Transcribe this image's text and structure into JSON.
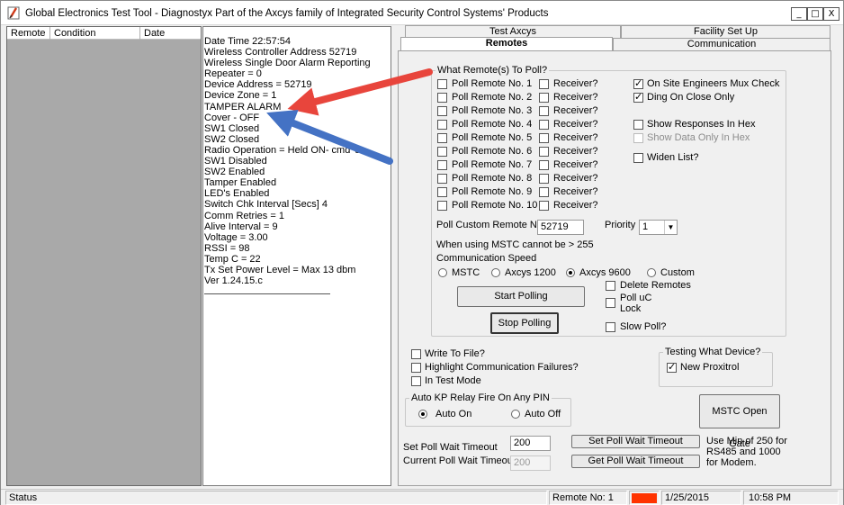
{
  "window": {
    "title": "Global Electronics Test Tool - Diagnostyx  Part of the Axcys family of Integrated Security Control Systems' Products",
    "controls": [
      "_",
      "□",
      "X"
    ]
  },
  "list": {
    "columns": [
      "Remote",
      "Condition",
      "Date"
    ]
  },
  "log": {
    "lines": [
      "Date Time 22:57:54",
      "Wireless Controller Address 52719",
      "Wireless Single Door Alarm Reporting",
      "Repeater = 0",
      "Device Address = 52719",
      "Device Zone = 1",
      "TAMPER ALARM",
      "Cover   - OFF",
      "SW1 Closed",
      "SW2 Closed",
      "Radio Operation = Held ON- cmd 's'",
      "SW1 Disabled",
      "SW2 Enabled",
      "Tamper Enabled",
      "LED's Enabled",
      "Switch Chk Interval [Secs] 4",
      "Comm Retries = 1",
      " Alive Interval = 9",
      "Voltage = 3.00",
      "RSSI = 98",
      "Temp C = 22",
      "Tx Set Power Level = Max 13 dbm",
      "Ver 1.24.15.c"
    ]
  },
  "tabs": {
    "test_axcys": "Test Axcys",
    "facility_setup": "Facility Set Up",
    "remotes": "Remotes",
    "communication": "Communication"
  },
  "poll_group": {
    "legend": "What Remote(s) To Poll?",
    "remotes": [
      "Poll Remote No. 1",
      "Poll Remote No. 2",
      "Poll Remote No. 3",
      "Poll Remote No. 4",
      "Poll Remote No. 5",
      "Poll Remote No. 6",
      "Poll Remote No. 7",
      "Poll Remote No. 8",
      "Poll Remote No. 9",
      "Poll Remote No. 10"
    ],
    "receiver_label": "Receiver?",
    "on_site_mux": "On Site Engineers Mux Check",
    "ding_on_close": "Ding On Close Only",
    "show_hex": "Show Responses In Hex",
    "show_data_hex": "Show Data Only  In Hex",
    "widen_list": "Widen List?",
    "custom_remote_label": "Poll Custom Remote No.",
    "custom_remote_value": "52719",
    "priority_label": "Priority",
    "priority_value": "1",
    "mstc_note": "When using MSTC cannot be > 255",
    "comm_speed_label": "Communication Speed",
    "speeds": [
      "MSTC",
      "Axcys 1200",
      "Axcys 9600",
      "Custom"
    ],
    "start_polling": "Start Polling",
    "stop_polling": "Stop Polling",
    "delete_remotes": "Delete Remotes",
    "poll_uc_lock_1": "Poll uC",
    "poll_uc_lock_2": "Lock",
    "slow_poll": "Slow Poll?"
  },
  "options": {
    "write_to_file": "Write To File?",
    "highlight_failures": "Highlight Communication Failures?",
    "in_test_mode": "In Test Mode"
  },
  "testing_device": {
    "legend": "Testing What Device?",
    "new_proxitrol": "New Proxitrol"
  },
  "auto_kp": {
    "legend": "Auto KP Relay Fire On Any PIN",
    "auto_on": "Auto On",
    "auto_off": "Auto Off"
  },
  "mstc_open_gate": "MSTC Open Gate",
  "timeouts": {
    "set_label": "Set Poll Wait Timeout",
    "set_value": "200",
    "current_label": "Current Poll Wait Timeout",
    "current_value": "200",
    "set_button": "Set Poll Wait Timeout",
    "get_button": "Get Poll Wait Timeout",
    "note_1": "Use Min of 250 for",
    "note_2": "RS485 and 1000",
    "note_3": "for Modem."
  },
  "status": {
    "label": "Status",
    "remote_no": "Remote No: 1",
    "indicator_color": "#ff3300",
    "date": "1/25/2015",
    "time": "10:58 PM"
  },
  "annotations": {
    "red_arrow_color": "#e8453c",
    "blue_arrow_color": "#4472c4"
  }
}
